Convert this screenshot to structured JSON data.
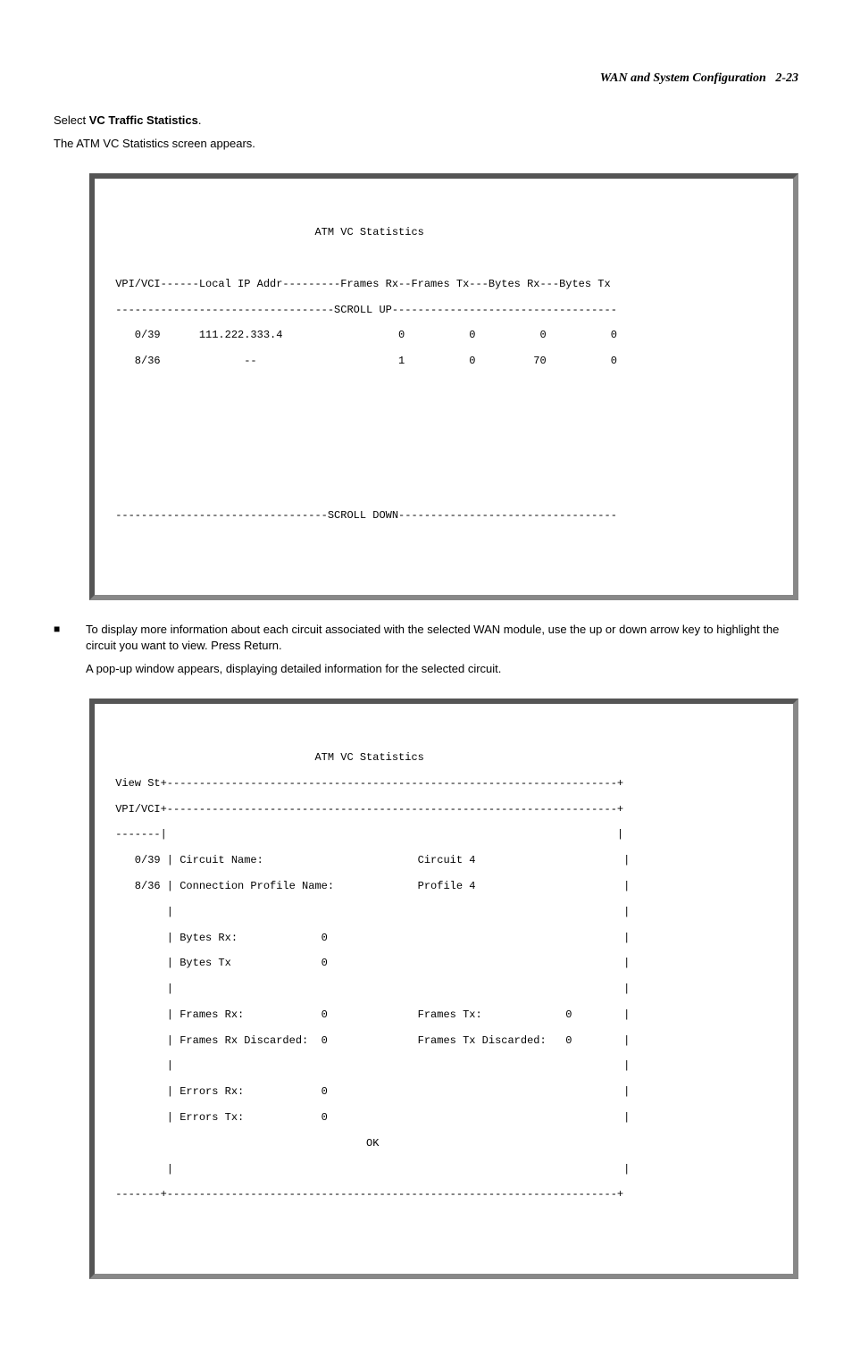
{
  "header": {
    "section": "WAN and System Configuration",
    "page": "2-23"
  },
  "intro": {
    "select_prefix": "Select ",
    "select_bold": "VC Traffic Statistics",
    "select_suffix": ".",
    "appears": "The ATM VC Statistics screen appears."
  },
  "terminal1": {
    "title": "                                ATM VC Statistics",
    "blank": "",
    "header_line": " VPI/VCI------Local IP Addr---------Frames Rx--Frames Tx---Bytes Rx---Bytes Tx",
    "scroll_up": " ----------------------------------SCROLL UP-----------------------------------",
    "row1": "    0/39      111.222.333.4                  0          0          0          0",
    "row2": "    8/36             --                      1          0         70          0",
    "scroll_down": " ---------------------------------SCROLL DOWN----------------------------------"
  },
  "bullet": {
    "line1": "To display more information about each circuit associated with the selected WAN module, use the up or down arrow key to highlight the circuit you want to view. Press Return.",
    "line2": "A pop-up window appears, displaying detailed information for the selected circuit."
  },
  "terminal2": {
    "title": "                                ATM VC Statistics",
    "viewst": " View St+----------------------------------------------------------------------+",
    "vpivci": " VPI/VCI+----------------------------------------------------------------------+",
    "dash": " -------|                                                                      |",
    "r1": "    0/39 | Circuit Name:                        Circuit 4                       |",
    "r2": "    8/36 | Connection Profile Name:             Profile 4                       |",
    "r3": "         |                                                                      |",
    "r4": "         | Bytes Rx:             0                                              |",
    "r5": "         | Bytes Tx              0                                              |",
    "r6": "         |                                                                      |",
    "r7": "         | Frames Rx:            0              Frames Tx:             0        |",
    "r8": "         | Frames Rx Discarded:  0              Frames Tx Discarded:   0        |",
    "r9": "         |                                                                      |",
    "r10": "         | Errors Rx:            0                                              |",
    "r11": "         | Errors Tx:            0                                              |",
    "ok": "                                        OK",
    "blankpipe": "         |                                                                      |",
    "bottom": " -------+----------------------------------------------------------------------+"
  }
}
